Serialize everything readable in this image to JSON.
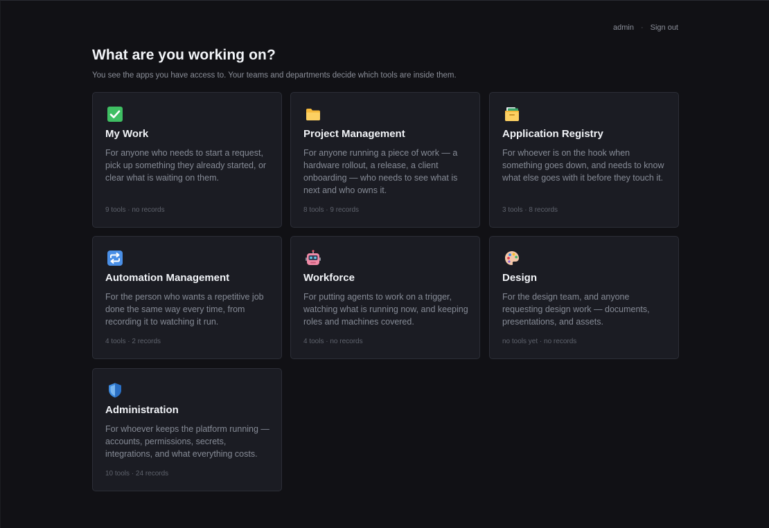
{
  "topbar": {
    "user": "admin",
    "separator": "·",
    "signout": "Sign out"
  },
  "header": {
    "title": "What are you working on?",
    "subtitle": "You see the apps you have access to. Your teams and departments decide which tools are inside them."
  },
  "cards": [
    {
      "icon": "check-box-icon",
      "title": "My Work",
      "description": "For anyone who needs to start a request, pick up something they already started, or clear what is waiting on them.",
      "meta": "9 tools · no records"
    },
    {
      "icon": "folder-icon",
      "title": "Project Management",
      "description": "For anyone running a piece of work — a hardware rollout, a release, a client onboarding — who needs to see what is next and who owns it.",
      "meta": "8 tools · 9 records"
    },
    {
      "icon": "card-file-box-icon",
      "title": "Application Registry",
      "description": "For whoever is on the hook when something goes down, and needs to know what else goes with it before they touch it.",
      "meta": "3 tools · 8 records"
    },
    {
      "icon": "repeat-arrows-icon",
      "title": "Automation Management",
      "description": "For the person who wants a repetitive job done the same way every time, from recording it to watching it run.",
      "meta": "4 tools · 2 records"
    },
    {
      "icon": "robot-icon",
      "title": "Workforce",
      "description": "For putting agents to work on a trigger, watching what is running now, and keeping roles and machines covered.",
      "meta": "4 tools · no records"
    },
    {
      "icon": "palette-icon",
      "title": "Design",
      "description": "For the design team, and anyone requesting design work — documents, presentations, and assets.",
      "meta": "no tools yet · no records"
    },
    {
      "icon": "shield-icon",
      "title": "Administration",
      "description": "For whoever keeps the platform running — accounts, permissions, secrets, integrations, and what everything costs.",
      "meta": "10 tools · 24 records"
    }
  ]
}
